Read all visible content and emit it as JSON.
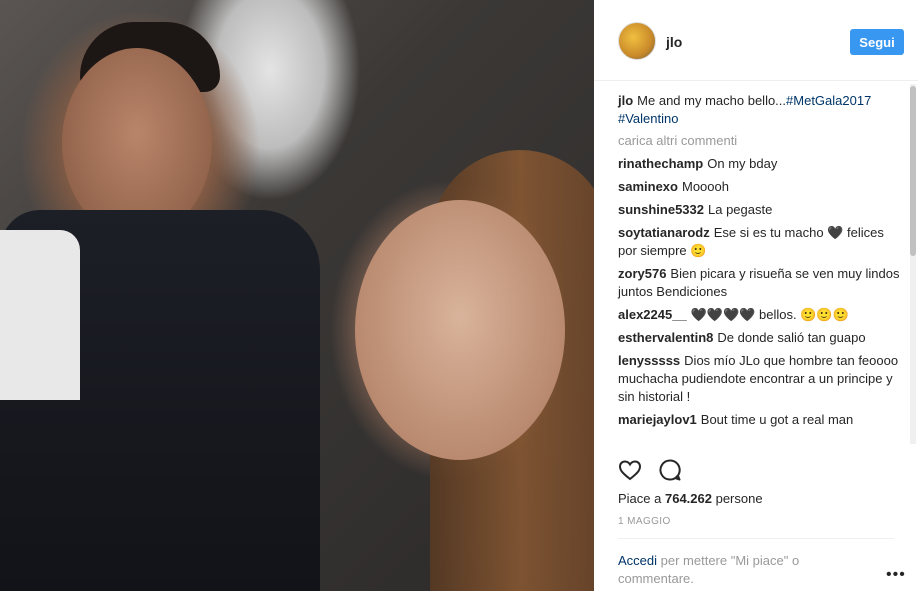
{
  "post": {
    "username": "jlo",
    "follow_label": "Segui",
    "caption": {
      "user": "jlo",
      "text": "Me and my macho bello...",
      "hashtags": [
        "#MetGala2017",
        "#Valentino"
      ]
    },
    "load_more_label": "carica altri commenti",
    "comments": [
      {
        "user": "rinathechamp",
        "text": "On my bday"
      },
      {
        "user": "saminexo",
        "text": "Mooooh"
      },
      {
        "user": "sunshine5332",
        "text": "La pegaste"
      },
      {
        "user": "soytatianarodz",
        "text": "Ese si es tu macho 🖤 felices por siempre 🙂"
      },
      {
        "user": "zory576",
        "text": "Bien picara y risueña se ven muy lindos juntos Bendiciones"
      },
      {
        "user": "alex2245__",
        "text": "🖤🖤🖤🖤 bellos. 🙂🙂🙂"
      },
      {
        "user": "esthervalentin8",
        "text": "De donde salió tan guapo"
      },
      {
        "user": "lenysssss",
        "text": "Dios mío JLo que hombre tan feoooo muchacha pudiendote encontrar a un principe y sin historial !"
      },
      {
        "user": "mariejaylov1",
        "text": "Bout time u got a real man"
      }
    ],
    "likes": {
      "prefix": "Piace a ",
      "count": "764.262",
      "suffix": " persone"
    },
    "date": "1 maggio",
    "login_prompt": {
      "link": "Accedi",
      "text": " per mettere \"Mi piace\" o commentare."
    },
    "more_label": "•••",
    "icons": {
      "like": "heart-icon",
      "comment": "comment-icon"
    },
    "colors": {
      "accent": "#3897f0",
      "link": "#003569",
      "muted": "#999999",
      "text": "#262626"
    }
  }
}
